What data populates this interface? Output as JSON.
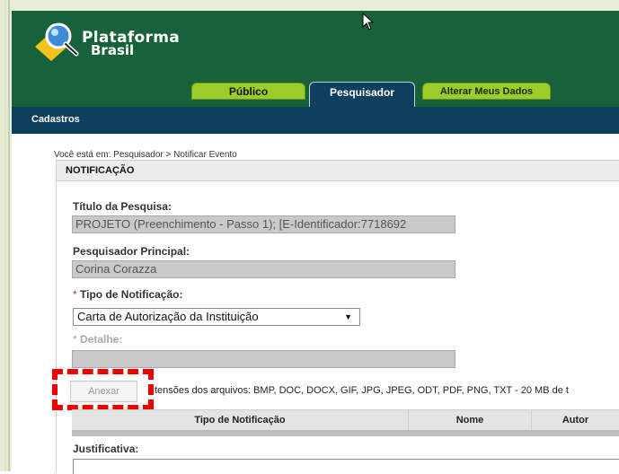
{
  "header": {
    "logo_line1": "Plataforma",
    "logo_line2": "Brasil",
    "tabs": [
      {
        "label": "Público"
      },
      {
        "label": "Pesquisador"
      },
      {
        "label": "Alterar Meus Dados"
      }
    ]
  },
  "navbar": {
    "item": "Cadastros"
  },
  "breadcrumb": "Você está em: Pesquisador > Notificar Evento",
  "panel": {
    "title": "NOTIFICAÇÃO",
    "titulo_label": "Título da Pesquisa:",
    "titulo_value": "PROJETO (Preenchimento - Passo 1); [E-Identificador:7718692",
    "pesquisador_label": "Pesquisador Principal:",
    "pesquisador_value": "Corina Corazza",
    "tipo_label": "Tipo de Notificação:",
    "tipo_value": "Carta de Autorização da Instituição",
    "detalhe_label": "Detalhe:",
    "required_mark": "*",
    "anexar_label": "Anexar",
    "extensions_text": "tensões dos arquivos: BMP, DOC, DOCX, GIF, JPG, JPEG, ODT, PDF, PNG, TXT - 20 MB de t",
    "table_headers": [
      "Tipo de Notificação",
      "Nome",
      "Autor"
    ],
    "justificativa_label": "Justificativa:"
  },
  "colors": {
    "header_green": "#17613b",
    "nav_blue": "#0e3f5e",
    "tab_green": "#9ccd2a",
    "highlight_red": "#f00000"
  }
}
